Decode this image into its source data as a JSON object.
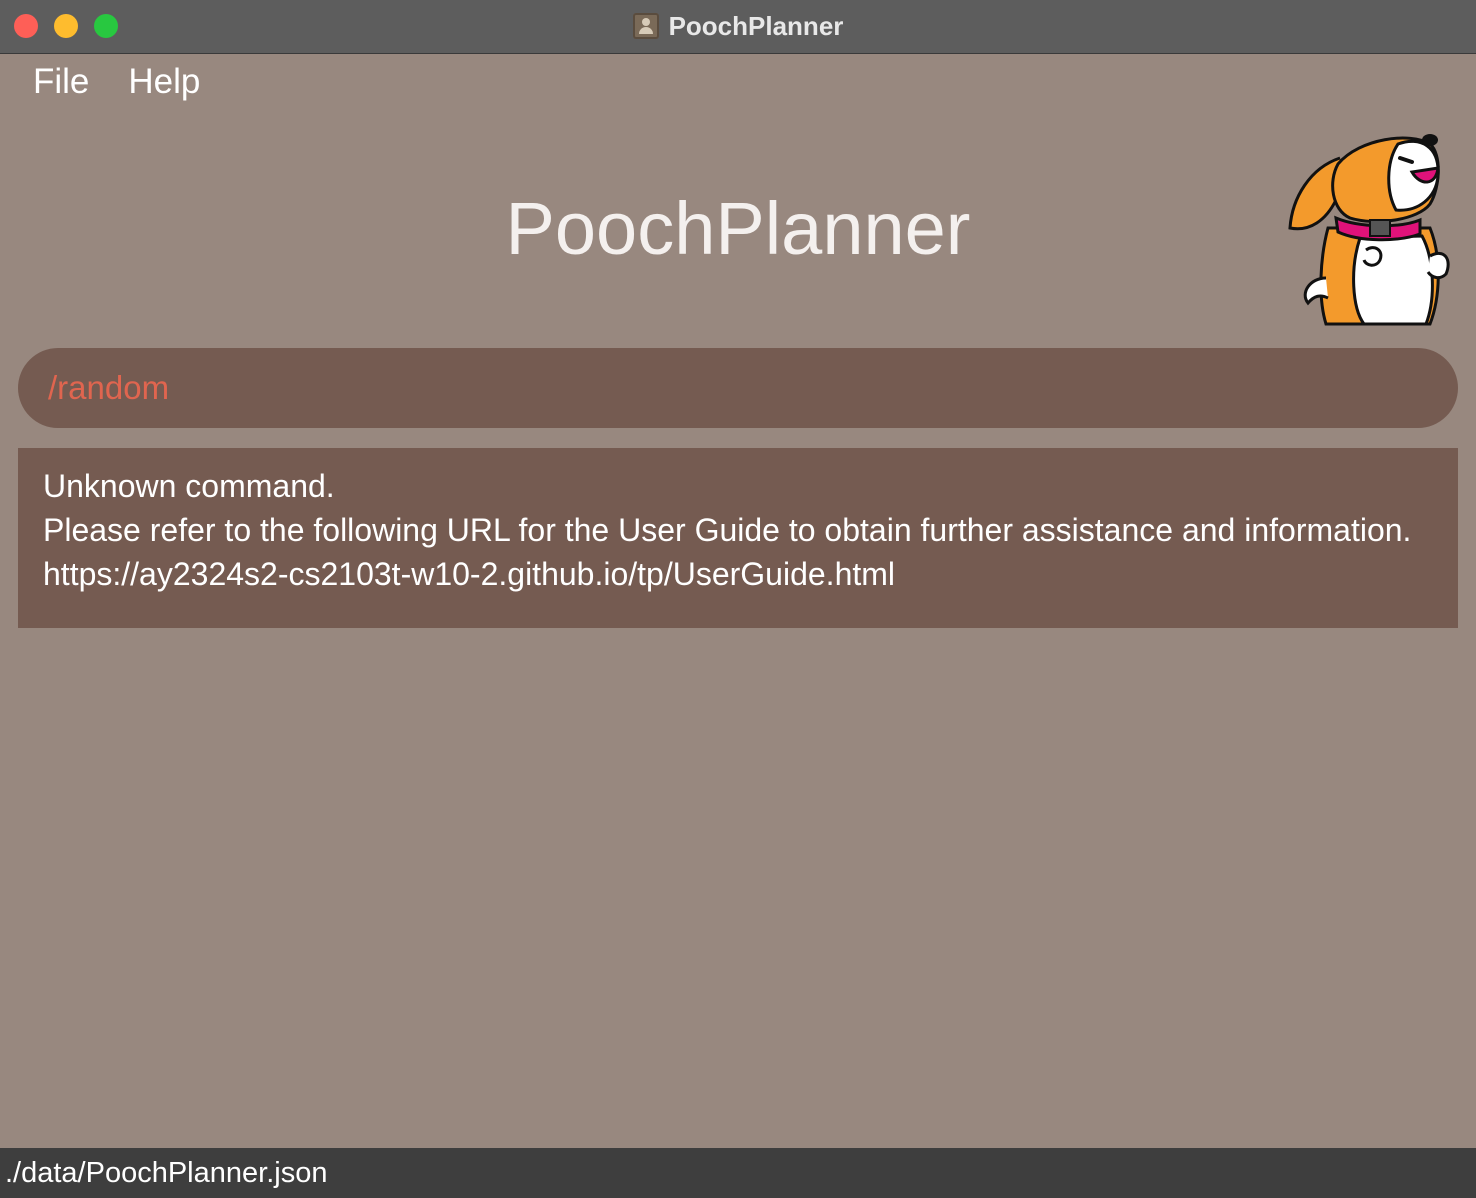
{
  "window": {
    "title": "PoochPlanner"
  },
  "menu": {
    "file": "File",
    "help": "Help"
  },
  "header": {
    "title": "PoochPlanner",
    "mascot_icon": "dog-mascot-icon"
  },
  "command": {
    "value": "/random",
    "text_color": "#e0654f"
  },
  "result": {
    "lines": [
      "Unknown command.",
      "Please refer to the following URL for the User Guide to obtain further assistance and information.",
      "https://ay2324s2-cs2103t-w10-2.github.io/tp/UserGuide.html"
    ]
  },
  "status": {
    "file_path": "./data/PoochPlanner.json"
  },
  "colors": {
    "background": "#98887f",
    "panel": "#755b51",
    "titlebar": "#5d5d5d",
    "statusbar": "#3e3e3e"
  }
}
